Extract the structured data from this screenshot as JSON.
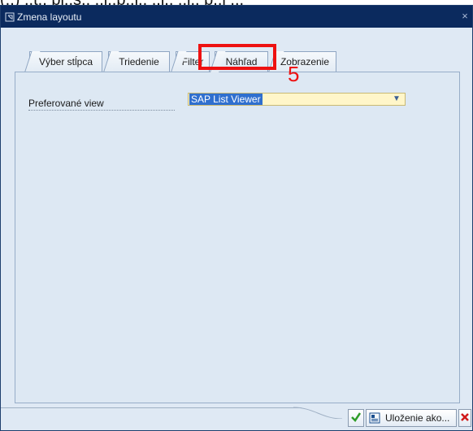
{
  "top_caption": "(..) ..t.. pl..s.. ..l..p..l.. ..l.. ..l.. p..l ...",
  "window": {
    "title": "Zmena layoutu",
    "close_glyph": "×"
  },
  "tabs": [
    {
      "label": "Výber stĺpca"
    },
    {
      "label": "Triedenie"
    },
    {
      "label": "Filter"
    },
    {
      "label": "Náhľad",
      "active": true
    },
    {
      "label": "Zobrazenie"
    }
  ],
  "form": {
    "field_label": "Preferované view",
    "dropdown_value": "SAP List Viewer"
  },
  "annotation": {
    "number": "5",
    "color": "#ee1111"
  },
  "footer": {
    "save_as_label": "Uloženie ako..."
  },
  "colors": {
    "titlebar": "#0b2a5e",
    "panel": "#dde8f3",
    "dropdown_bg": "#fff6c9",
    "selection": "#2f6fcf"
  },
  "icons": {
    "window": "window-icon",
    "confirm": "check-icon",
    "save": "save-layout-icon",
    "cancel": "cancel-x-icon"
  }
}
